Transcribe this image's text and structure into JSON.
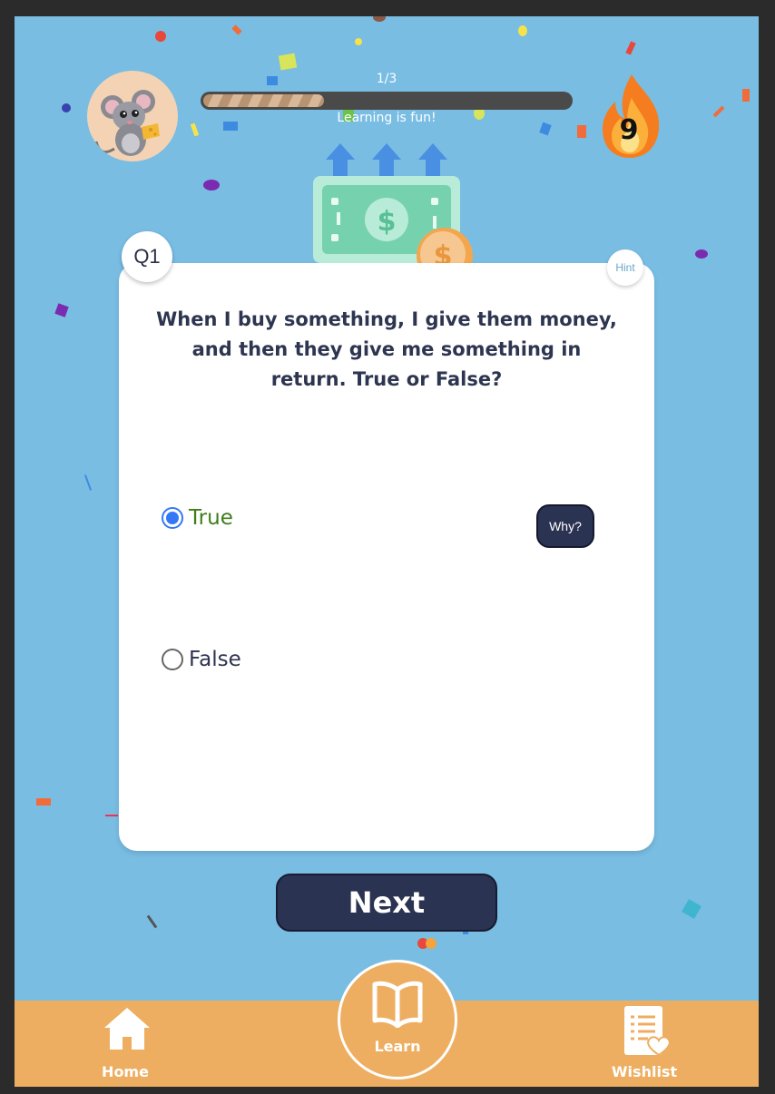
{
  "header": {
    "progress_counter": "1/3",
    "progress_fraction": 0.33,
    "progress_caption": "Learning is fun!",
    "streak_count": "9",
    "avatar_icon": "mouse-with-cheese",
    "streak_icon": "fire-icon"
  },
  "question": {
    "badge": "Q1",
    "hint_label": "Hint",
    "text": "When I buy something, I give them money, and then they give me something in return. True or False?",
    "options": [
      {
        "label": "True",
        "selected": true
      },
      {
        "label": "False",
        "selected": false
      }
    ],
    "why_label": "Why?"
  },
  "next_label": "Next",
  "nav": {
    "home_label": "Home",
    "learn_label": "Learn",
    "wishlist_label": "Wishlist"
  },
  "colors": {
    "background": "#79bde3",
    "card": "#ffffff",
    "dark_button": "#2b3352",
    "nav_bar": "#eeae61",
    "correct_text": "#3f7d1b",
    "radio_selected": "#3478f6"
  }
}
